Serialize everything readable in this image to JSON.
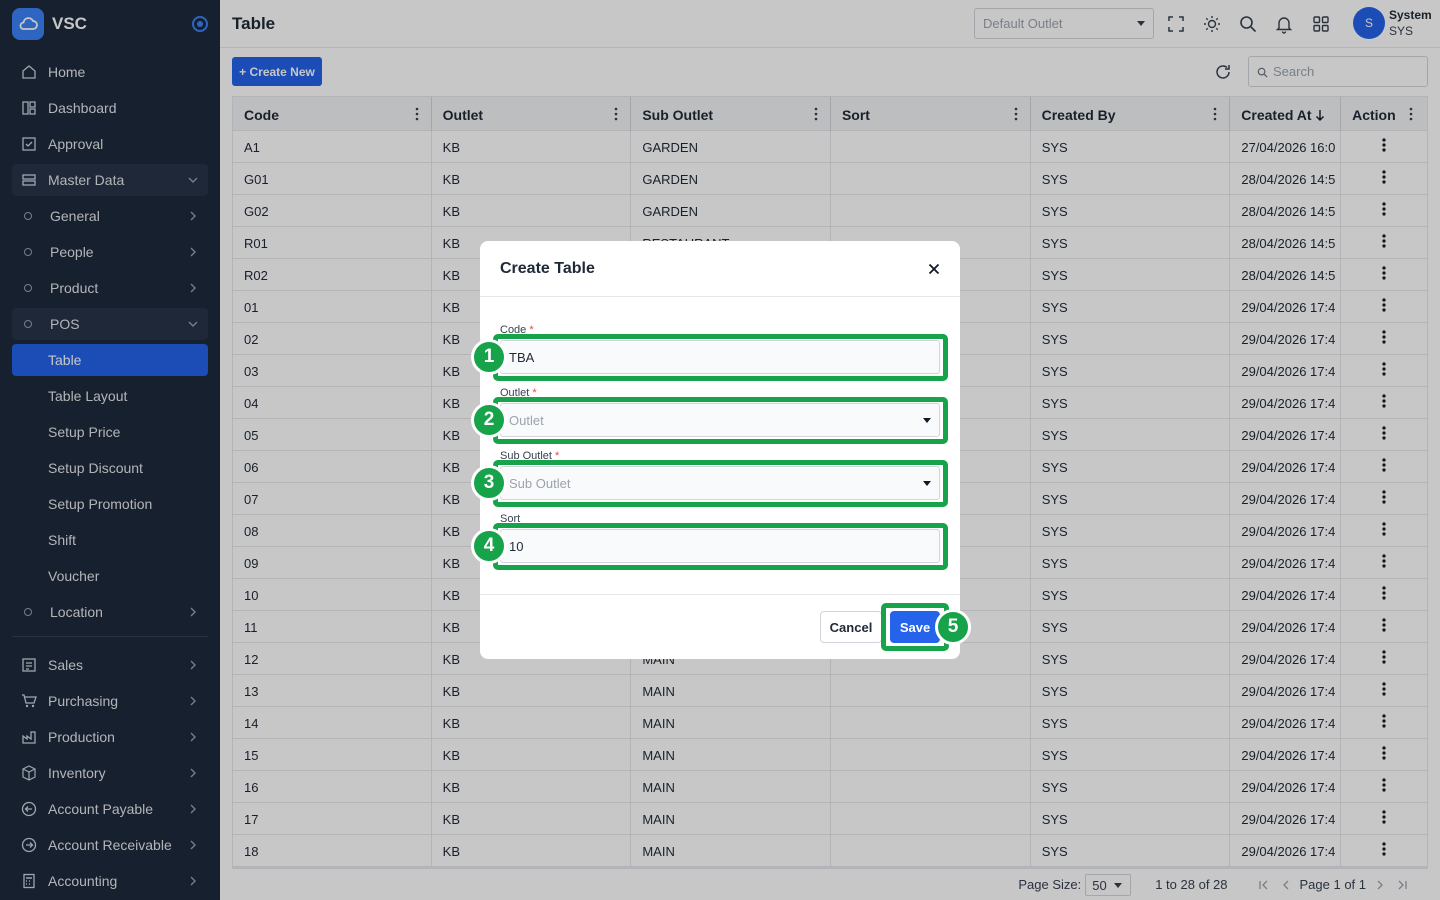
{
  "app": {
    "name": "VSC",
    "page_title": "Table"
  },
  "sidebar": {
    "items": [
      {
        "label": "Home",
        "icon": "home-icon"
      },
      {
        "label": "Dashboard",
        "icon": "dashboard-icon"
      },
      {
        "label": "Approval",
        "icon": "approval-icon"
      },
      {
        "label": "Master Data",
        "icon": "database-icon",
        "expanded": true
      },
      {
        "label": "General",
        "icon": "circle-icon"
      },
      {
        "label": "People",
        "icon": "circle-icon"
      },
      {
        "label": "Product",
        "icon": "circle-icon"
      },
      {
        "label": "POS",
        "icon": "circle-icon",
        "expanded": true
      },
      {
        "label": "Table",
        "active": true
      },
      {
        "label": "Table Layout"
      },
      {
        "label": "Setup Price"
      },
      {
        "label": "Setup Discount"
      },
      {
        "label": "Setup Promotion"
      },
      {
        "label": "Shift"
      },
      {
        "label": "Voucher"
      },
      {
        "label": "Location",
        "icon": "circle-icon"
      }
    ],
    "bottom_items": [
      {
        "label": "Sales",
        "icon": "sales-icon"
      },
      {
        "label": "Purchasing",
        "icon": "cart-icon"
      },
      {
        "label": "Production",
        "icon": "production-icon"
      },
      {
        "label": "Inventory",
        "icon": "box-icon"
      },
      {
        "label": "Account Payable",
        "icon": "arrow-left-circle-icon"
      },
      {
        "label": "Account Receivable",
        "icon": "arrow-right-circle-icon"
      },
      {
        "label": "Accounting",
        "icon": "calculator-icon"
      }
    ]
  },
  "topbar": {
    "outlet_placeholder": "Default Outlet",
    "user_initial": "S",
    "user_name": "System",
    "user_code": "SYS"
  },
  "toolbar": {
    "create_label": "+ Create New",
    "search_placeholder": "Search"
  },
  "grid": {
    "columns": [
      "Code",
      "Outlet",
      "Sub Outlet",
      "Sort",
      "Created By",
      "Created At",
      "Action"
    ],
    "rows": [
      [
        "A1",
        "KB",
        "GARDEN",
        "",
        "SYS",
        "27/04/2026 16:0"
      ],
      [
        "G01",
        "KB",
        "GARDEN",
        "",
        "SYS",
        "28/04/2026 14:5"
      ],
      [
        "G02",
        "KB",
        "GARDEN",
        "",
        "SYS",
        "28/04/2026 14:5"
      ],
      [
        "R01",
        "KB",
        "RESTAURANT",
        "",
        "SYS",
        "28/04/2026 14:5"
      ],
      [
        "R02",
        "KB",
        "",
        "",
        "SYS",
        "28/04/2026 14:5"
      ],
      [
        "01",
        "KB",
        "",
        "",
        "SYS",
        "29/04/2026 17:4"
      ],
      [
        "02",
        "KB",
        "",
        "",
        "SYS",
        "29/04/2026 17:4"
      ],
      [
        "03",
        "KB",
        "",
        "",
        "SYS",
        "29/04/2026 17:4"
      ],
      [
        "04",
        "KB",
        "",
        "",
        "SYS",
        "29/04/2026 17:4"
      ],
      [
        "05",
        "KB",
        "",
        "",
        "SYS",
        "29/04/2026 17:4"
      ],
      [
        "06",
        "KB",
        "",
        "",
        "SYS",
        "29/04/2026 17:4"
      ],
      [
        "07",
        "KB",
        "",
        "",
        "SYS",
        "29/04/2026 17:4"
      ],
      [
        "08",
        "KB",
        "",
        "",
        "SYS",
        "29/04/2026 17:4"
      ],
      [
        "09",
        "KB",
        "",
        "",
        "SYS",
        "29/04/2026 17:4"
      ],
      [
        "10",
        "KB",
        "",
        "",
        "SYS",
        "29/04/2026 17:4"
      ],
      [
        "11",
        "KB",
        "",
        "",
        "SYS",
        "29/04/2026 17:4"
      ],
      [
        "12",
        "KB",
        "MAIN",
        "",
        "SYS",
        "29/04/2026 17:4"
      ],
      [
        "13",
        "KB",
        "MAIN",
        "",
        "SYS",
        "29/04/2026 17:4"
      ],
      [
        "14",
        "KB",
        "MAIN",
        "",
        "SYS",
        "29/04/2026 17:4"
      ],
      [
        "15",
        "KB",
        "MAIN",
        "",
        "SYS",
        "29/04/2026 17:4"
      ],
      [
        "16",
        "KB",
        "MAIN",
        "",
        "SYS",
        "29/04/2026 17:4"
      ],
      [
        "17",
        "KB",
        "MAIN",
        "",
        "SYS",
        "29/04/2026 17:4"
      ],
      [
        "18",
        "KB",
        "MAIN",
        "",
        "SYS",
        "29/04/2026 17:4"
      ]
    ],
    "sort_indicator": "descending"
  },
  "pager": {
    "page_size_label": "Page Size:",
    "page_size": "50",
    "range": "1 to 28 of 28",
    "page_text": "Page 1 of 1"
  },
  "modal": {
    "title": "Create Table",
    "code_label": "Code",
    "code_value": "TBA",
    "outlet_label": "Outlet",
    "outlet_placeholder": "Outlet",
    "sub_outlet_label": "Sub Outlet",
    "sub_outlet_placeholder": "Sub Outlet",
    "sort_label": "Sort",
    "sort_value": "10",
    "required_mark": "*",
    "cancel_label": "Cancel",
    "save_label": "Save"
  },
  "annotations": [
    "1",
    "2",
    "3",
    "4",
    "5"
  ],
  "colors": {
    "sidebar_bg": "#1e293b",
    "accent": "#2563eb",
    "annotation": "#16a34a"
  }
}
